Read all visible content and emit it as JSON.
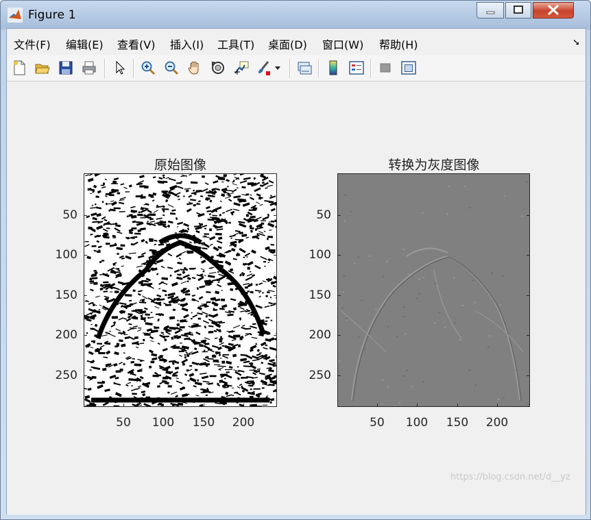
{
  "window": {
    "title": "Figure 1",
    "controls": [
      "minimize",
      "maximize",
      "close"
    ]
  },
  "menubar": {
    "items": [
      "文件(F)",
      "编辑(E)",
      "查看(V)",
      "插入(I)",
      "工具(T)",
      "桌面(D)",
      "窗口(W)",
      "帮助(H)"
    ],
    "pin_icon": "dock-arrow-icon"
  },
  "toolbar": {
    "icons": [
      "new-figure-icon",
      "open-file-icon",
      "save-icon",
      "print-icon",
      "pointer-icon",
      "zoom-in-icon",
      "zoom-out-icon",
      "pan-hand-icon",
      "rotate-3d-icon",
      "data-cursor-icon",
      "brush-icon",
      "brush-dropdown-icon",
      "link-plot-icon",
      "colorbar-icon",
      "legend-icon",
      "hide-plot-tools-icon",
      "show-plot-tools-icon"
    ]
  },
  "figure": {
    "subplots": [
      {
        "title": "原始图像",
        "rendering": "binary black-and-white image",
        "yticks": [
          "50",
          "100",
          "150",
          "200",
          "250"
        ],
        "xticks": [
          "50",
          "100",
          "150",
          "200"
        ]
      },
      {
        "title": "转换为灰度图像",
        "rendering": "embossed gray image",
        "yticks": [
          "50",
          "100",
          "150",
          "200",
          "250"
        ],
        "xticks": [
          "50",
          "100",
          "150",
          "200"
        ]
      }
    ]
  },
  "watermark": "https://blog.csdn.net/d__yz",
  "colors": {
    "axes_bg_gray": "#808080",
    "figure_bg": "#f0f0f0"
  }
}
